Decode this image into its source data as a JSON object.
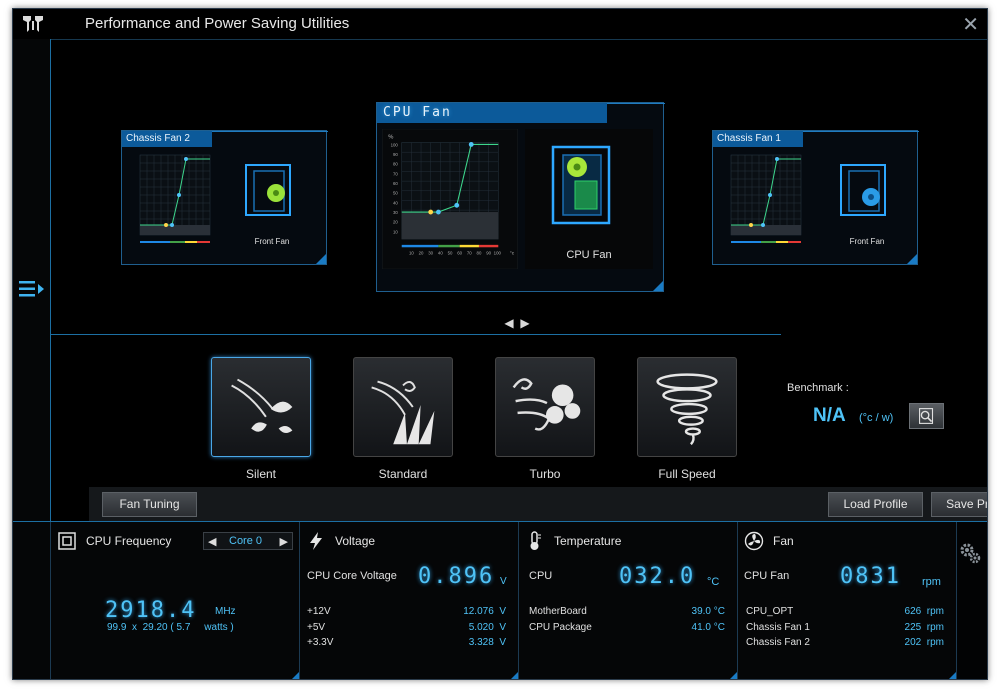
{
  "window": {
    "title": "Performance and Power Saving Utilities"
  },
  "fans": {
    "left": {
      "name": "Chassis Fan 2",
      "label": "Front Fan"
    },
    "center": {
      "name": "CPU Fan",
      "label": "CPU Fan",
      "y_unit": "%",
      "x_unit": "°c",
      "y_ticks": [
        "100",
        "90",
        "80",
        "70",
        "60",
        "50",
        "40",
        "30",
        "20",
        "10"
      ],
      "x_ticks": [
        "10",
        "20",
        "30",
        "40",
        "50",
        "60",
        "70",
        "80",
        "90",
        "100"
      ]
    },
    "right": {
      "name": "Chassis Fan 1",
      "label": "Front Fan"
    }
  },
  "modes": [
    {
      "label": "Silent",
      "active": true
    },
    {
      "label": "Standard",
      "active": false
    },
    {
      "label": "Turbo",
      "active": false
    },
    {
      "label": "Full Speed",
      "active": false
    }
  ],
  "benchmark": {
    "label": "Benchmark :",
    "value": "N/A",
    "unit": "(°c / w)"
  },
  "buttons": {
    "fan_tuning": "Fan Tuning",
    "load_profile": "Load Profile",
    "save_profile": "Save Profile"
  },
  "cpu": {
    "title": "CPU Frequency",
    "core": "Core 0",
    "freq": "2918.4",
    "freq_unit": "MHz",
    "detail": "99.9  x  29.20 ( 5.7     watts )"
  },
  "voltage": {
    "title": "Voltage",
    "core_label": "CPU Core Voltage",
    "core_value": "0.896",
    "core_unit": "V",
    "rows": [
      {
        "label": "+12V",
        "value": "12.076  V"
      },
      {
        "label": "+5V",
        "value": "5.020  V"
      },
      {
        "label": "+3.3V",
        "value": "3.328  V"
      }
    ]
  },
  "temperature": {
    "title": "Temperature",
    "cpu_label": "CPU",
    "cpu_value": "032.0",
    "cpu_unit": "°C",
    "rows": [
      {
        "label": "MotherBoard",
        "value": "39.0 °C"
      },
      {
        "label": "CPU Package",
        "value": "41.0 °C"
      }
    ]
  },
  "fan": {
    "title": "Fan",
    "cpu_label": "CPU Fan",
    "cpu_value": "0831",
    "cpu_unit": "rpm",
    "rows": [
      {
        "label": "CPU_OPT",
        "value": "626  rpm"
      },
      {
        "label": "Chassis Fan 1",
        "value": "225  rpm"
      },
      {
        "label": "Chassis Fan 2",
        "value": "202  rpm"
      }
    ]
  },
  "colors": {
    "accent": "#4fc3f7",
    "border": "#1c6fa3",
    "header": "#0c5a9a"
  }
}
